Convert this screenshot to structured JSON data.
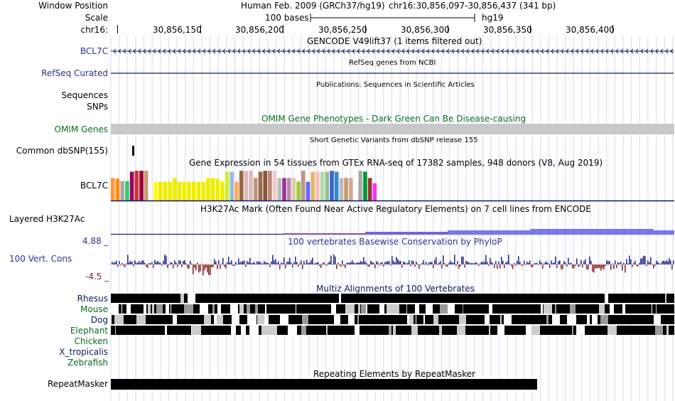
{
  "header": {
    "window_position_label": "Window Position",
    "scale_label": "Scale",
    "chrom_label": "chr16:",
    "assembly": "Human Feb. 2009 (GRCh37/hg19)",
    "position": "chr16:30,856,097-30,856,437 (341 bp)",
    "scale_text": "100 bases",
    "db": "hg19",
    "ticks": [
      "30,856,150",
      "30,856,200",
      "30,856,250",
      "30,856,300",
      "30,856,350",
      "30,856,400"
    ]
  },
  "tracks": {
    "gencode": {
      "title": "GENCODE V49lift37 (1 items filtered out)",
      "label": "BCL7C"
    },
    "refseq": {
      "title": "RefSeq genes from NCBI",
      "label": "RefSeq Curated"
    },
    "pubs": {
      "title": "Publications: Sequences in Scientific Articles",
      "label": "Sequences"
    },
    "snps_label": "SNPs",
    "omim": {
      "title": "OMIM Gene Phenotypes - Dark Green Can Be Disease-causing",
      "label": "OMIM Genes"
    },
    "dbsnp": {
      "title": "Short Genetic Variants from dbSNP release 155",
      "label": "Common dbSNP(155)"
    },
    "gtex": {
      "title": "Gene Expression in 54 tissues from GTEx RNA-seq of 17382 samples, 948 donors (V8, Aug 2019)",
      "label": "BCL7C",
      "bars": [
        {
          "c": "#ff9933",
          "v": 0.72
        },
        {
          "c": "#ff8a1a",
          "v": 0.7
        },
        {
          "c": "#aaaaaa",
          "v": 0.62
        },
        {
          "c": "#33cc66",
          "v": 0.62
        },
        {
          "c": "#990066",
          "v": 0.92
        },
        {
          "c": "#cc3333",
          "v": 0.95
        },
        {
          "c": "#990033",
          "v": 0.95
        },
        {
          "c": "#cc9977",
          "v": 0.95
        },
        {
          "c": "#ffffff",
          "v": 0.0
        },
        {
          "c": "#ffff00",
          "v": 0.6
        },
        {
          "c": "#eeee00",
          "v": 0.6
        },
        {
          "c": "#eeee00",
          "v": 0.6
        },
        {
          "c": "#eeee00",
          "v": 0.6
        },
        {
          "c": "#eeee00",
          "v": 0.72
        },
        {
          "c": "#eeee00",
          "v": 0.6
        },
        {
          "c": "#eeee00",
          "v": 0.6
        },
        {
          "c": "#eeee00",
          "v": 0.6
        },
        {
          "c": "#eeee00",
          "v": 0.6
        },
        {
          "c": "#eeee00",
          "v": 0.6
        },
        {
          "c": "#eeee00",
          "v": 0.6
        },
        {
          "c": "#eeee00",
          "v": 0.72
        },
        {
          "c": "#eeee00",
          "v": 0.72
        },
        {
          "c": "#eeee00",
          "v": 0.7
        },
        {
          "c": "#eeee00",
          "v": 0.6
        },
        {
          "c": "#ccee33",
          "v": 0.92
        },
        {
          "c": "#99bbdd",
          "v": 0.92
        },
        {
          "c": "#ffaa55",
          "v": 0.6
        },
        {
          "c": "#996644",
          "v": 0.95
        },
        {
          "c": "#ddbbbb",
          "v": 0.95
        },
        {
          "c": "#ddbbbb",
          "v": 0.95
        },
        {
          "c": "#bb9977",
          "v": 0.72
        },
        {
          "c": "#996655",
          "v": 0.92
        },
        {
          "c": "#885533",
          "v": 0.95
        },
        {
          "c": "#bb8877",
          "v": 0.95
        },
        {
          "c": "#eecccc",
          "v": 0.95
        },
        {
          "c": "#bbbbbb",
          "v": 0.72
        },
        {
          "c": "#993399",
          "v": 0.72
        },
        {
          "c": "#bb88aa",
          "v": 0.72
        },
        {
          "c": "#ddccaa",
          "v": 0.72
        },
        {
          "c": "#99cc33",
          "v": 0.6
        },
        {
          "c": "#bb9988",
          "v": 0.95
        },
        {
          "c": "#6666ff",
          "v": 0.6
        },
        {
          "c": "#ddbb66",
          "v": 0.92
        },
        {
          "c": "#ffbbbb",
          "v": 0.92
        },
        {
          "c": "#aaddaa",
          "v": 0.92
        },
        {
          "c": "#99bb99",
          "v": 0.92
        },
        {
          "c": "#3366cc",
          "v": 0.95
        },
        {
          "c": "#3388cc",
          "v": 0.92
        },
        {
          "c": "#bbbbbb",
          "v": 0.72
        },
        {
          "c": "#cc9966",
          "v": 0.72
        },
        {
          "c": "#ccaa99",
          "v": 0.72
        },
        {
          "c": "#ffffff",
          "v": 0.0
        },
        {
          "c": "#aaaaaa",
          "v": 0.95
        },
        {
          "c": "#009933",
          "v": 0.92
        },
        {
          "c": "#993333",
          "v": 0.72
        },
        {
          "c": "#ff33ee",
          "v": 0.55
        }
      ]
    },
    "h3k27ac": {
      "title": "H3K27Ac Mark (Often Found Near Active Regulatory Elements) on 7 cell lines from ENCODE",
      "label": "Layered H3K27Ac"
    },
    "phylop": {
      "title": "100 vertebrates Basewise Conservation by PhyloP",
      "label": "100 Vert. Cons",
      "max": "4.88 _",
      "min": "-4.5 _"
    },
    "multiz": {
      "title": "Multiz Alignments of 100 Vertebrates",
      "species": [
        "Rhesus",
        "Mouse",
        "Dog",
        "Elephant",
        "Chicken",
        "X_tropicalis",
        "Zebrafish"
      ]
    },
    "repeatmasker": {
      "title": "Repeating Elements by RepeatMasker",
      "label": "RepeatMasker"
    }
  },
  "colors": {
    "label_blue": "#2e3192",
    "omim_gray": "#c8c8c8",
    "phylop_pos": "#2e3192",
    "phylop_neg": "#8b2e2e",
    "h3k27ac": "#7777ee"
  }
}
